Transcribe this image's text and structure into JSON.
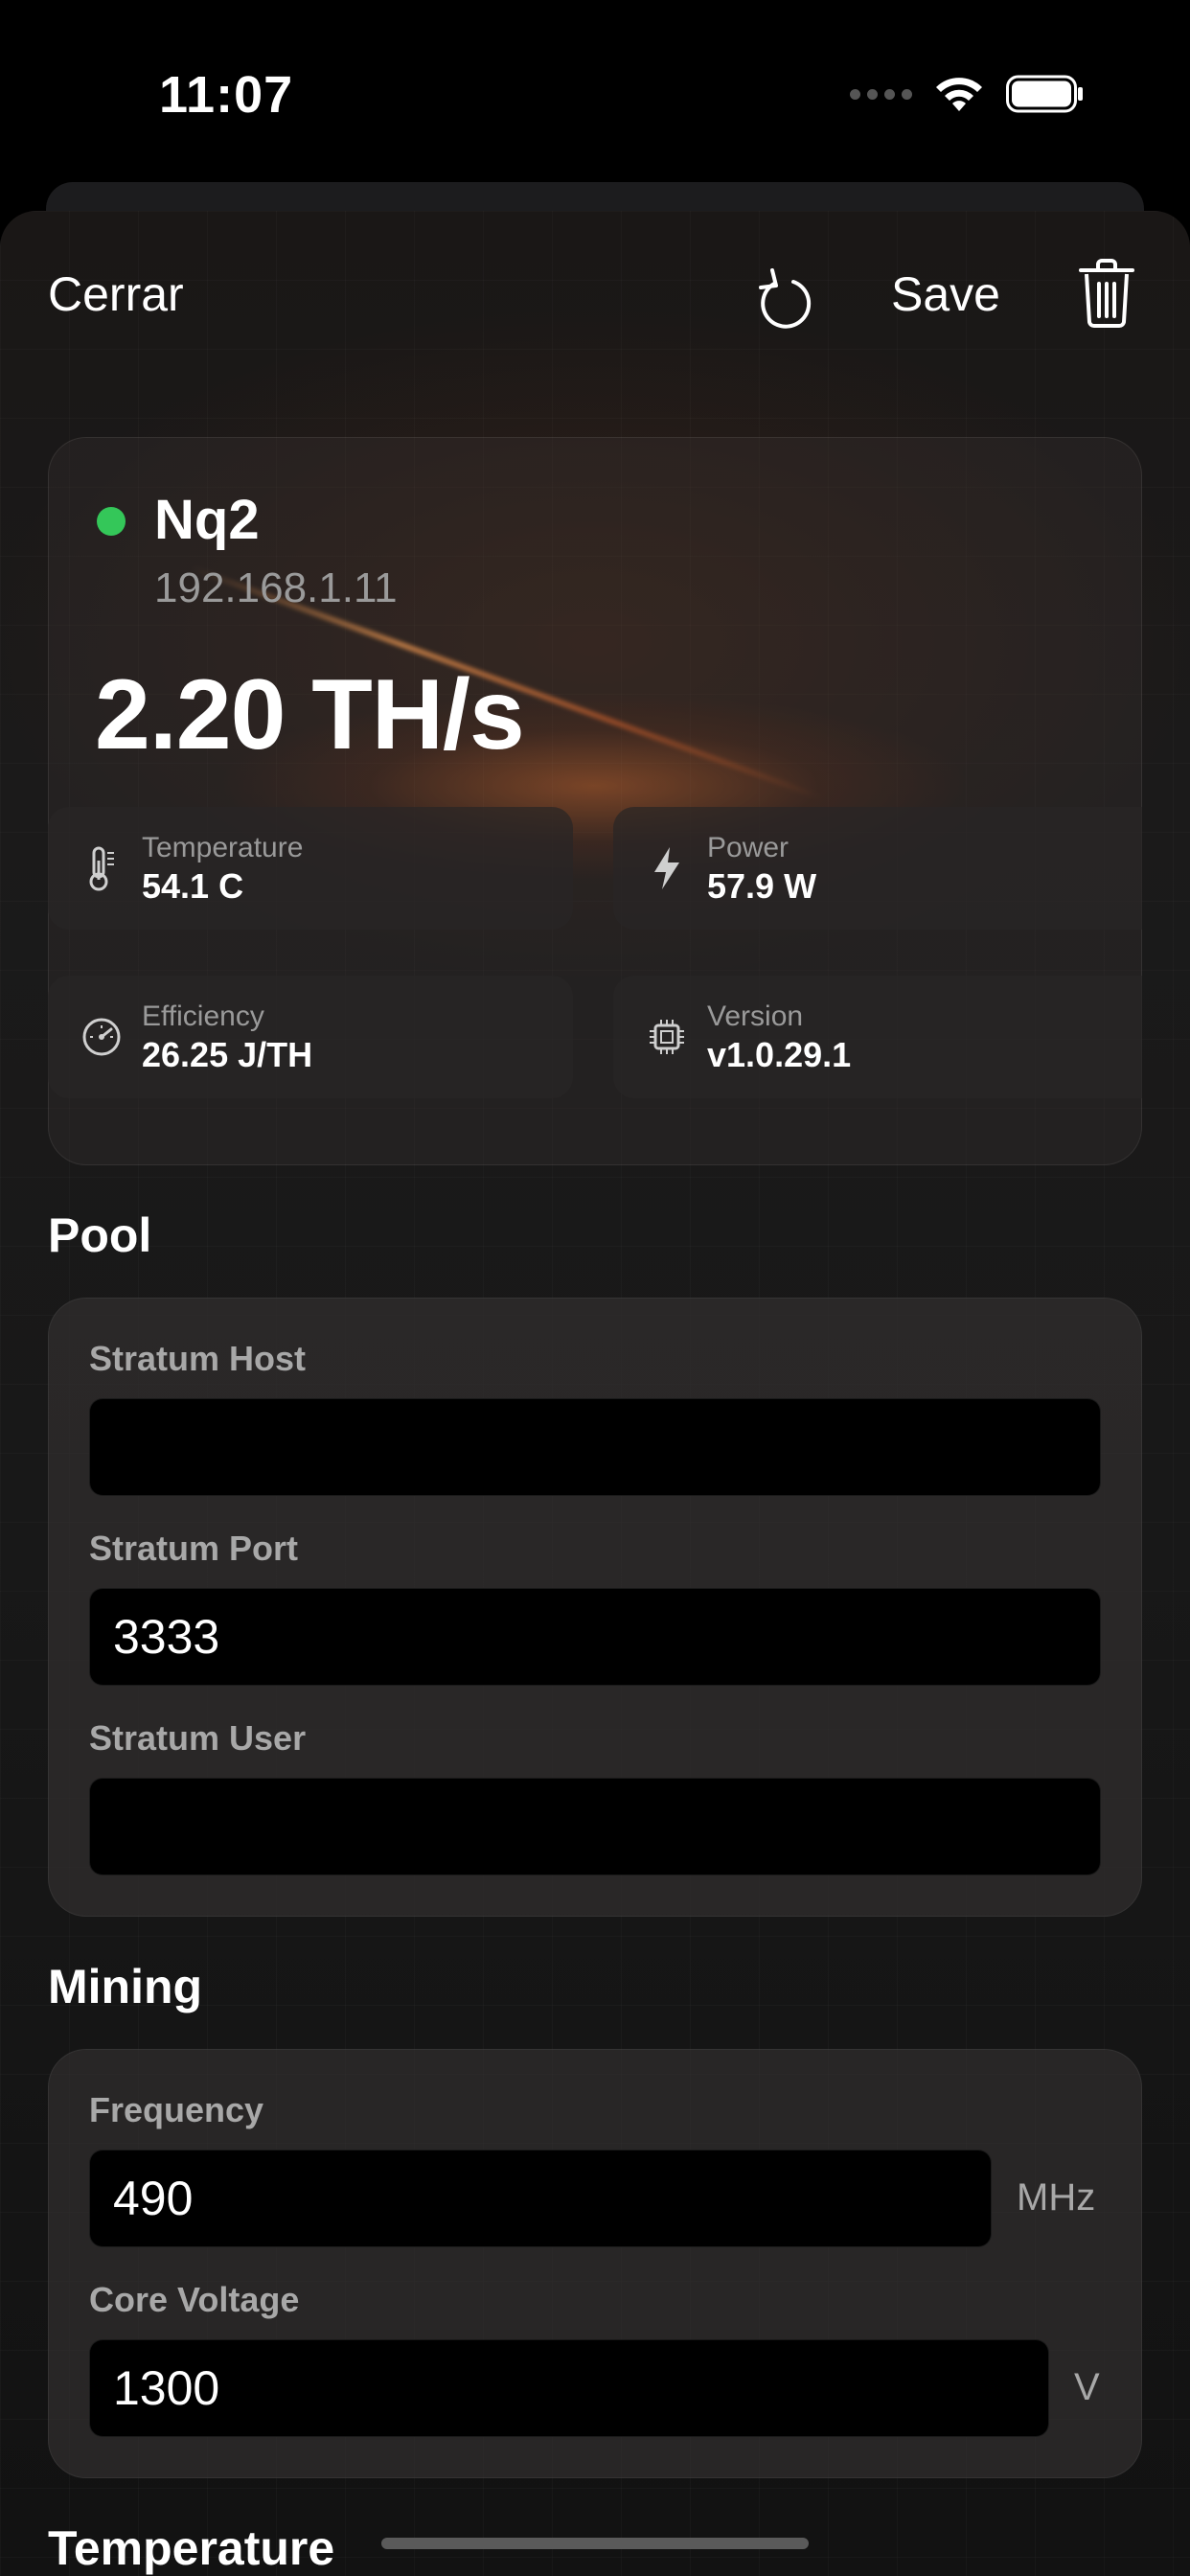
{
  "status_bar": {
    "time": "11:07"
  },
  "nav": {
    "close_label": "Cerrar",
    "save_label": "Save",
    "reset_icon": "reset-icon",
    "trash_icon": "trash-icon"
  },
  "device": {
    "name": "Nq2",
    "ip": "192.168.1.11",
    "online": true,
    "status_color": "#34c759",
    "hashrate": "2.20 TH/s",
    "stats": {
      "temperature": {
        "label": "Temperature",
        "value": "54.1 C",
        "icon": "thermometer-icon"
      },
      "power": {
        "label": "Power",
        "value": "57.9 W",
        "icon": "bolt-icon"
      },
      "efficiency": {
        "label": "Efficiency",
        "value": "26.25 J/TH",
        "icon": "gauge-icon"
      },
      "version": {
        "label": "Version",
        "value": "v1.0.29.1",
        "icon": "chip-icon"
      }
    }
  },
  "pool": {
    "title": "Pool",
    "stratum_host": {
      "label": "Stratum Host",
      "value": ""
    },
    "stratum_port": {
      "label": "Stratum Port",
      "value": "3333"
    },
    "stratum_user": {
      "label": "Stratum User",
      "value": ""
    }
  },
  "mining": {
    "title": "Mining",
    "frequency": {
      "label": "Frequency",
      "value": "490",
      "unit": "MHz"
    },
    "core_voltage": {
      "label": "Core Voltage",
      "value": "1300",
      "unit": "V"
    }
  },
  "temperature_section": {
    "title": "Temperature"
  }
}
